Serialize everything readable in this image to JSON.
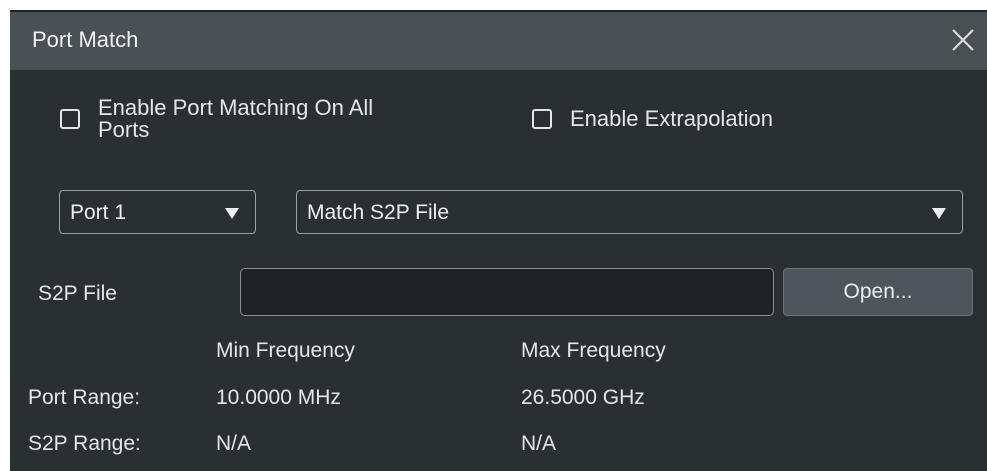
{
  "dialog": {
    "title": "Port Match",
    "close_icon": "close-icon"
  },
  "options": {
    "enable_all_ports_label_line1": "Enable Port Matching On All",
    "enable_all_ports_label_line2": "Ports",
    "enable_all_ports_checked": false,
    "enable_extrapolation_label": "Enable Extrapolation",
    "enable_extrapolation_checked": false
  },
  "port_select": {
    "value": "Port 1"
  },
  "match_select": {
    "value": "Match S2P File"
  },
  "s2p_file": {
    "label": "S2P File",
    "value": "",
    "placeholder": "",
    "open_label": "Open..."
  },
  "frequency_table": {
    "headers": [
      "Min Frequency",
      "Max Frequency"
    ],
    "rows": [
      {
        "label": "Port Range:",
        "min": "10.0000 MHz",
        "max": "26.5000 GHz"
      },
      {
        "label": "S2P Range:",
        "min": "N/A",
        "max": "N/A"
      }
    ]
  },
  "colors": {
    "background": "#2a2f32",
    "titlebar": "#4a5155",
    "button": "#4e565b",
    "text": "#e6e6e6"
  }
}
